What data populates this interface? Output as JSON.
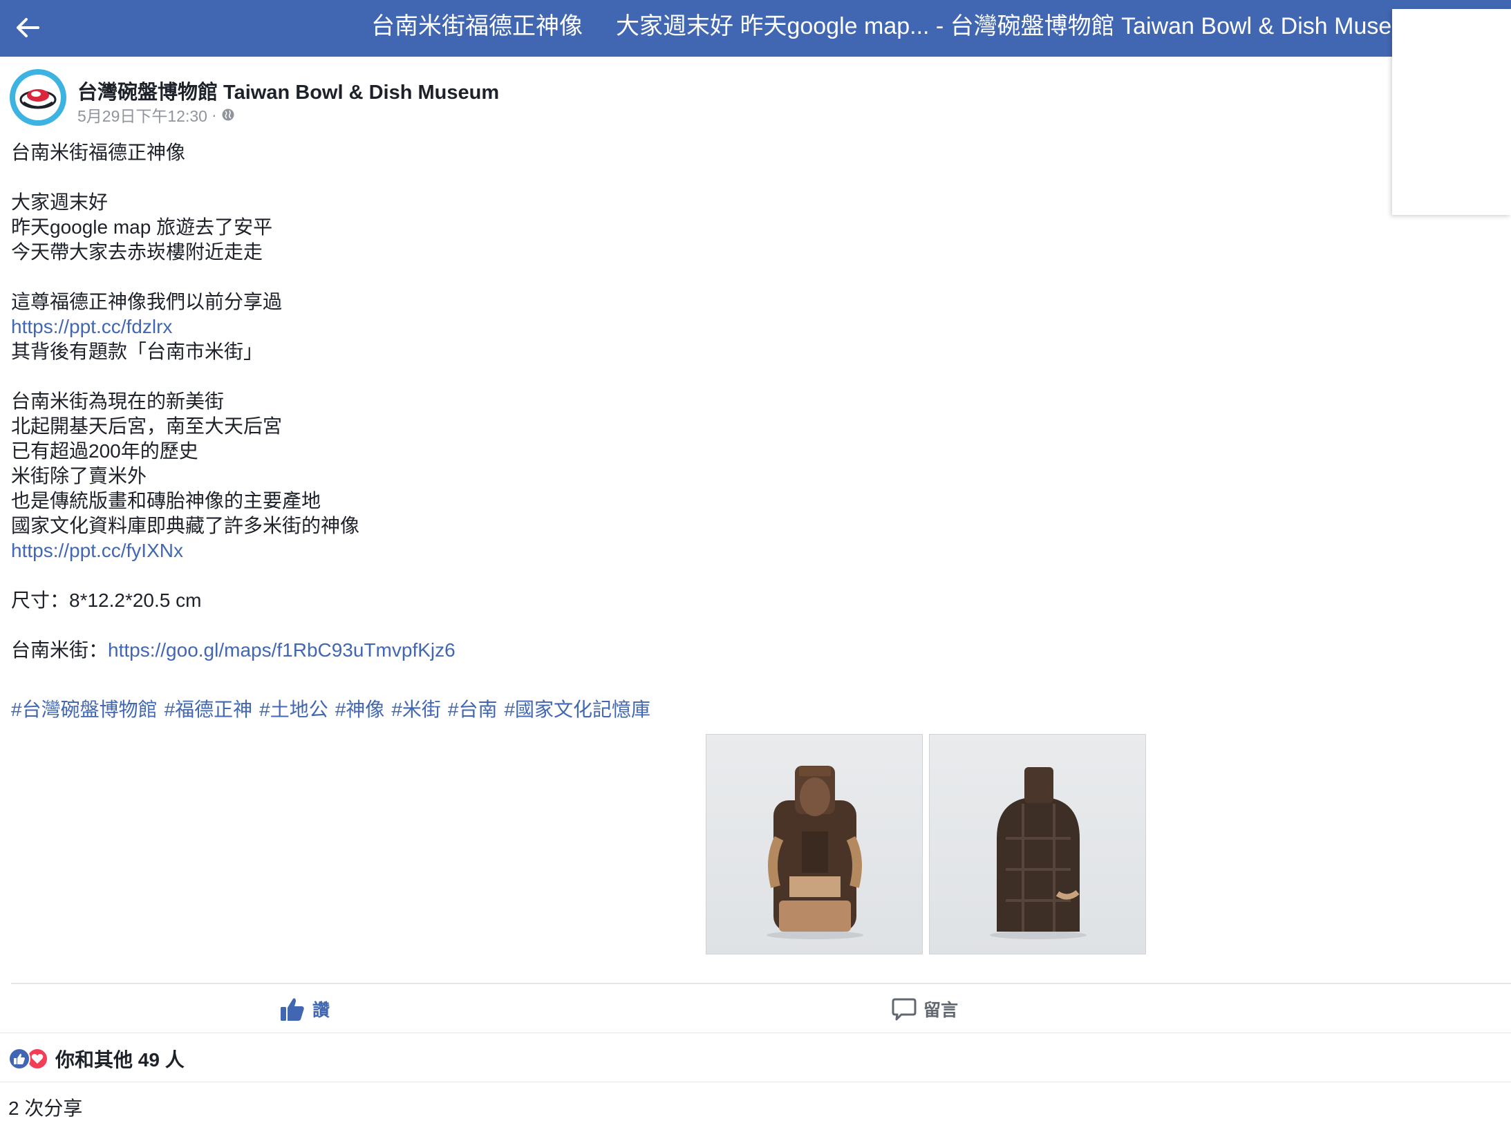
{
  "topbar": {
    "title_part1": "台南米街福德正神像",
    "title_part2": "大家週末好 昨天google map... - 台灣碗盤博物館 Taiwan Bowl & Dish Museum | F",
    "back_icon": "arrow-left-icon"
  },
  "post": {
    "page_name": "台灣碗盤博物館 Taiwan Bowl & Dish Museum",
    "timestamp": "5月29日下午12:30",
    "meta_separator": "·",
    "privacy_icon": "globe-icon",
    "body": {
      "title": "台南米街福德正神像",
      "para1": [
        "大家週末好",
        "昨天google map 旅遊去了安平",
        "今天帶大家去赤崁樓附近走走"
      ],
      "para2_line1": "這尊福德正神像我們以前分享過",
      "link1": "https://ppt.cc/fdzlrx",
      "para2_line2": "其背後有題款「台南市米街」",
      "para3": [
        "台南米街為現在的新美街",
        "北起開基天后宮，南至大天后宮",
        "已有超過200年的歷史",
        "米街除了賣米外",
        "也是傳統版畫和磚胎神像的主要產地",
        "國家文化資料庫即典藏了許多米街的神像"
      ],
      "link2": "https://ppt.cc/fyIXNx",
      "size_line": "尺寸：8*12.2*20.5 cm",
      "map_label": "台南米街：",
      "map_link": "https://goo.gl/maps/f1RbC93uTmvpfKjz6"
    },
    "hashtags": [
      "#台灣碗盤博物館",
      "#福德正神",
      "#土地公",
      "#神像",
      "#米街",
      "#台南",
      "#國家文化記憶庫"
    ],
    "photos": [
      "statue-front",
      "statue-back"
    ]
  },
  "actions": {
    "like_label": "讚",
    "comment_label": "留言"
  },
  "reactions": {
    "text": "你和其他 49 人",
    "icons": [
      "like-reaction-icon",
      "love-reaction-icon"
    ]
  },
  "shares": {
    "text": "2 次分享"
  },
  "colors": {
    "brand": "#4267b2",
    "link": "#4267b2",
    "meta": "#90949c",
    "love": "#f33e58"
  }
}
